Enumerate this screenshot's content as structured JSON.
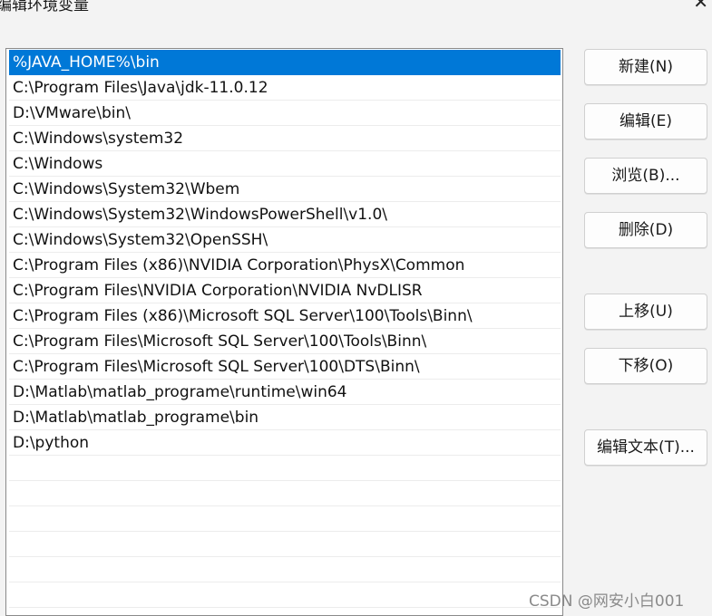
{
  "window": {
    "title": "编辑环境变量",
    "close_glyph": "✕"
  },
  "path_list": {
    "items": [
      "%JAVA_HOME%\\bin",
      "C:\\Program Files\\Java\\jdk-11.0.12",
      "D:\\VMware\\bin\\",
      "C:\\Windows\\system32",
      "C:\\Windows",
      "C:\\Windows\\System32\\Wbem",
      "C:\\Windows\\System32\\WindowsPowerShell\\v1.0\\",
      "C:\\Windows\\System32\\OpenSSH\\",
      "C:\\Program Files (x86)\\NVIDIA Corporation\\PhysX\\Common",
      "C:\\Program Files\\NVIDIA Corporation\\NVIDIA NvDLISR",
      "C:\\Program Files (x86)\\Microsoft SQL Server\\100\\Tools\\Binn\\",
      "C:\\Program Files\\Microsoft SQL Server\\100\\Tools\\Binn\\",
      "C:\\Program Files\\Microsoft SQL Server\\100\\DTS\\Binn\\",
      "D:\\Matlab\\matlab_programe\\runtime\\win64",
      "D:\\Matlab\\matlab_programe\\bin",
      "D:\\python",
      "",
      "",
      "",
      "",
      "",
      ""
    ],
    "selected_index": 0
  },
  "buttons": {
    "new": "新建(N)",
    "edit": "编辑(E)",
    "browse": "浏览(B)...",
    "delete": "删除(D)",
    "move_up": "上移(U)",
    "move_down": "下移(O)",
    "edit_text": "编辑文本(T)..."
  },
  "watermark": "CSDN @网安小白001",
  "colors": {
    "selection": "#0078d7",
    "background": "#f3f3f3"
  }
}
